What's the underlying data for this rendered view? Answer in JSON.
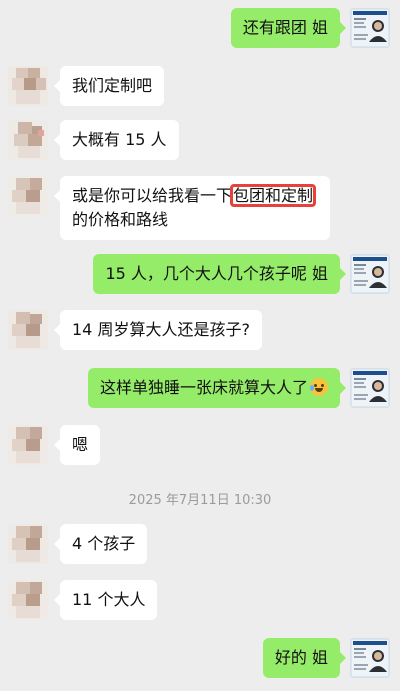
{
  "messages": [
    {
      "side": "right",
      "text": "还有跟团  姐"
    },
    {
      "side": "left",
      "text": "我们定制吧"
    },
    {
      "side": "left",
      "text": "大概有 15 人"
    },
    {
      "side": "left",
      "text_before": "或是你可以给我看一下",
      "highlight": "包团和定制",
      "text_line2": "的价格和路线"
    },
    {
      "side": "right",
      "text": "15 人，几个大人几个孩子呢  姐"
    },
    {
      "side": "left",
      "text": "14 周岁算大人还是孩子?"
    },
    {
      "side": "right",
      "text": "这样单独睡一张床就算大人了",
      "emoji": "laughing-tears-emoji"
    },
    {
      "side": "left",
      "text": "嗯"
    },
    {
      "side": "left",
      "text": "4 个孩子"
    },
    {
      "side": "left",
      "text": "11 个大人"
    },
    {
      "side": "right",
      "text": "好的  姐"
    }
  ],
  "timestamp": "2025 年7月11日 10:30",
  "colors": {
    "background": "#ededed",
    "bubble_self": "#95ec69",
    "bubble_other": "#ffffff",
    "highlight_box": "#e8413b"
  }
}
